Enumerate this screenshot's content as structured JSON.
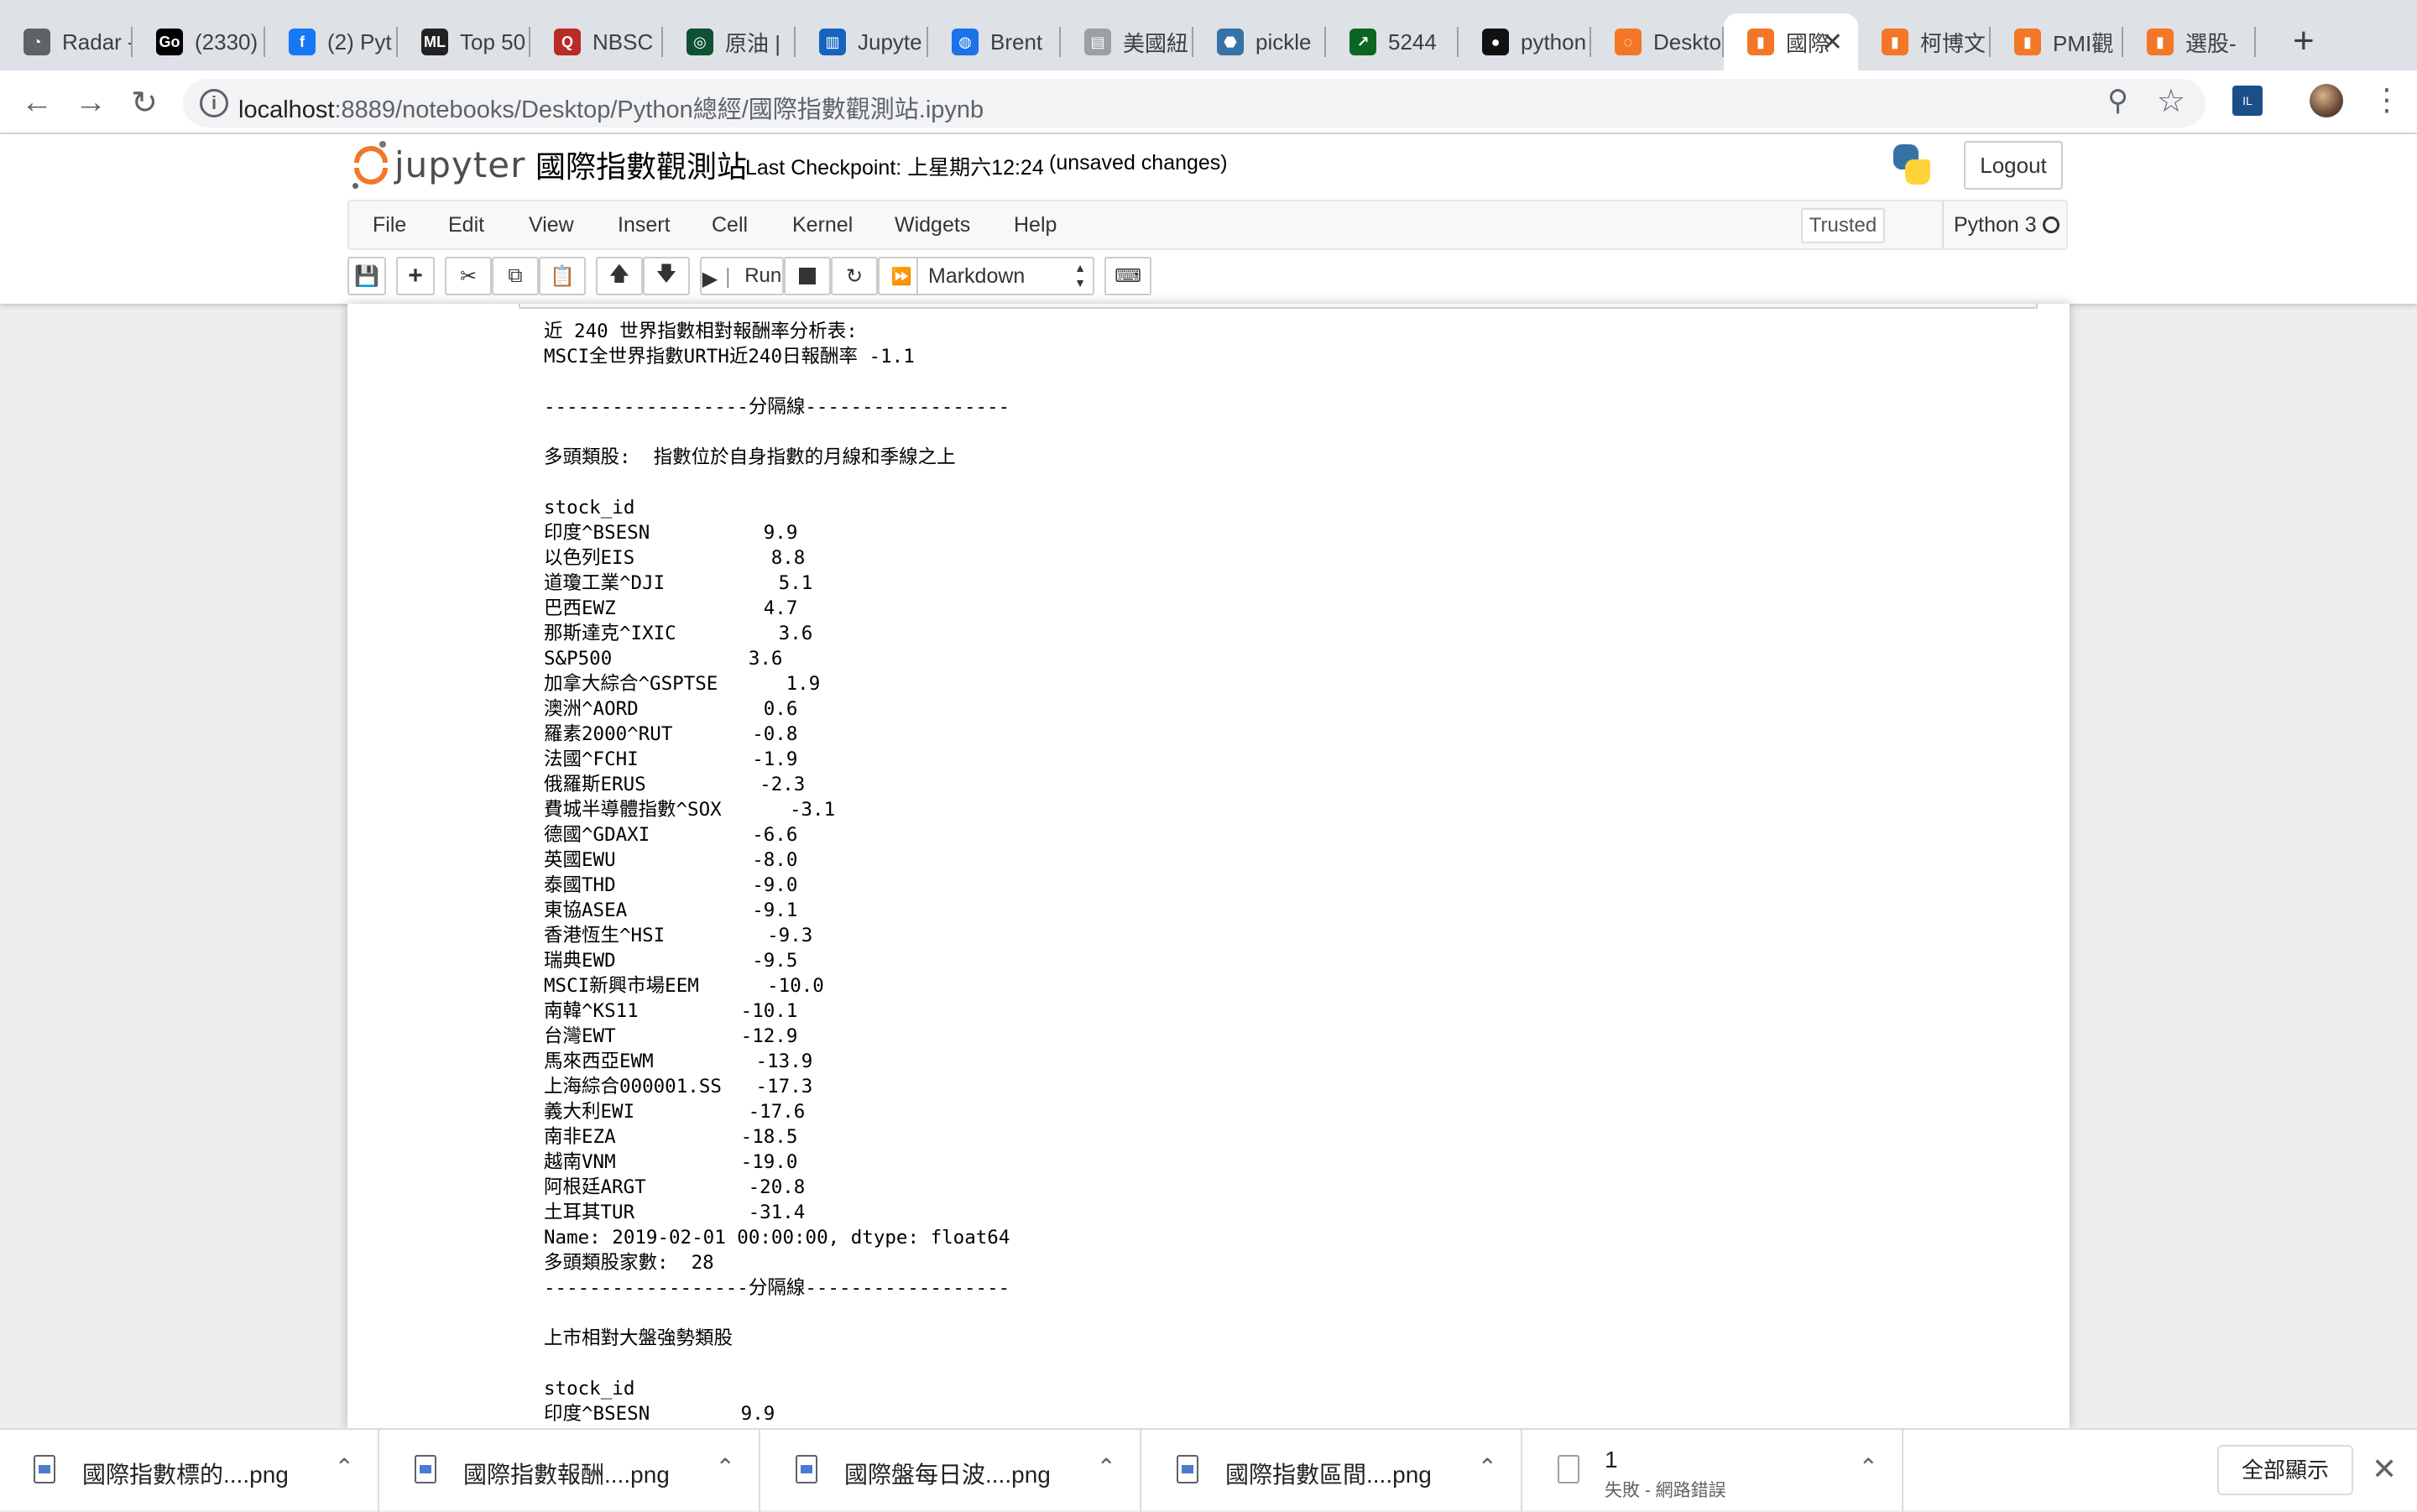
{
  "browser": {
    "tabs": [
      {
        "title": "Radar -",
        "icon": "radar-icon",
        "color": "#5f6368"
      },
      {
        "title": "(2330)",
        "icon": "go-icon",
        "color": "#000000"
      },
      {
        "title": "(2) Pyt",
        "icon": "facebook-icon",
        "color": "#1877f2"
      },
      {
        "title": "Top 50",
        "icon": "ml-icon",
        "color": "#222222"
      },
      {
        "title": "NBSC",
        "icon": "quora-icon",
        "color": "#b92b27"
      },
      {
        "title": "原油 |",
        "icon": "chart-icon",
        "color": "#0f5132"
      },
      {
        "title": "Jupyte",
        "icon": "bar-chart-icon",
        "color": "#1565c0"
      },
      {
        "title": "Brent",
        "icon": "globe-icon",
        "color": "#1a73e8"
      },
      {
        "title": "美國紐",
        "icon": "doc-icon",
        "color": "#9aa0a6"
      },
      {
        "title": "pickle",
        "icon": "python-icon",
        "color": "#3572a5"
      },
      {
        "title": "5244",
        "icon": "stock-icon",
        "color": "#0b6623"
      },
      {
        "title": "python",
        "icon": "github-icon",
        "color": "#111111"
      },
      {
        "title": "Deskto",
        "icon": "jupyter-icon",
        "color": "#f37726"
      },
      {
        "title": "國際",
        "icon": "book-icon",
        "color": "#f37726",
        "active": true
      },
      {
        "title": "柯博文",
        "icon": "book-icon",
        "color": "#f37726"
      },
      {
        "title": "PMI觀",
        "icon": "book-icon",
        "color": "#f37726"
      },
      {
        "title": "選股-",
        "icon": "book-icon",
        "color": "#f37726"
      }
    ],
    "new_tab": "+",
    "url_host": "localhost",
    "url_rest": ":8889/notebooks/Desktop/Python總經/國際指數觀測站.ipynb"
  },
  "jupyter": {
    "logo_text": "jupyter",
    "notebook_title": "國際指數觀測站",
    "checkpoint": "Last Checkpoint: 上星期六12:24",
    "autosave": "(unsaved changes)",
    "logout": "Logout",
    "menu": [
      "File",
      "Edit",
      "View",
      "Insert",
      "Cell",
      "Kernel",
      "Widgets",
      "Help"
    ],
    "trusted": "Trusted",
    "kernel": "Python 3",
    "run_label": "Run",
    "cell_type": "Markdown"
  },
  "output": {
    "lines": [
      "近 240 世界指數相對報酬率分析表:",
      "MSCI全世界指數URTH近240日報酬率 -1.1",
      "",
      "------------------分隔線------------------",
      "",
      "多頭類股:  指數位於自身指數的月線和季線之上",
      "",
      "stock_id",
      "印度^BSESN          9.9",
      "以色列EIS            8.8",
      "道瓊工業^DJI          5.1",
      "巴西EWZ             4.7",
      "那斯達克^IXIC         3.6",
      "S&P500            3.6",
      "加拿大綜合^GSPTSE      1.9",
      "澳洲^AORD           0.6",
      "羅素2000^RUT       -0.8",
      "法國^FCHI          -1.9",
      "俄羅斯ERUS          -2.3",
      "費城半導體指數^SOX      -3.1",
      "德國^GDAXI         -6.6",
      "英國EWU            -8.0",
      "泰國THD            -9.0",
      "東協ASEA           -9.1",
      "香港恆生^HSI         -9.3",
      "瑞典EWD            -9.5",
      "MSCI新興市場EEM      -10.0",
      "南韓^KS11         -10.1",
      "台灣EWT           -12.9",
      "馬來西亞EWM         -13.9",
      "上海綜合000001.SS   -17.3",
      "義大利EWI          -17.6",
      "南非EZA           -18.5",
      "越南VNM           -19.0",
      "阿根廷ARGT         -20.8",
      "土耳其TUR          -31.4",
      "Name: 2019-02-01 00:00:00, dtype: float64",
      "多頭類股家數:  28",
      "------------------分隔線------------------",
      "",
      "上市相對大盤強勢類股",
      "",
      "stock_id",
      "印度^BSESN        9.9"
    ]
  },
  "downloads": {
    "items": [
      {
        "name": "國際指數標的....png"
      },
      {
        "name": "國際指數報酬....png"
      },
      {
        "name": "國際盤每日波....png"
      },
      {
        "name": "國際指數區間....png"
      }
    ],
    "failed": {
      "name": "1",
      "status": "失敗 - 網路錯誤"
    },
    "show_all": "全部顯示"
  }
}
